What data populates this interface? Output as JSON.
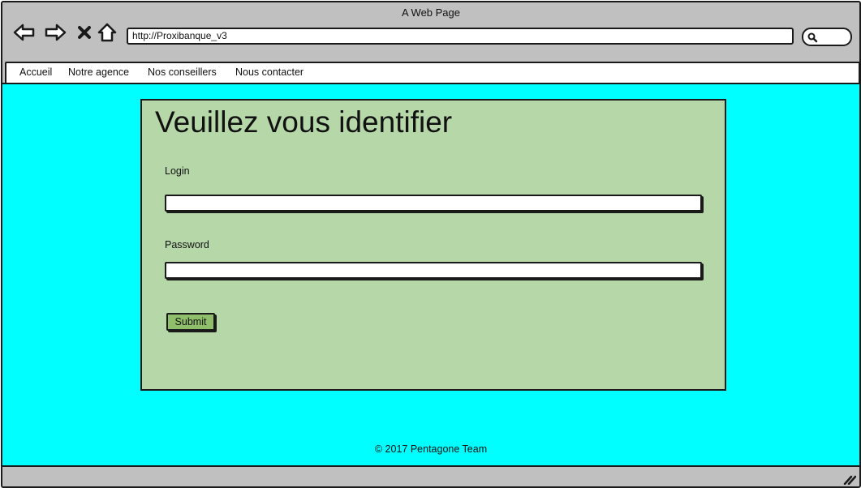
{
  "window": {
    "title": "A Web Page"
  },
  "browser": {
    "address": "http://Proxibanque_v3",
    "icons": [
      "back-arrow-icon",
      "forward-arrow-icon",
      "close-x-icon",
      "home-icon",
      "search-icon",
      "resize-grip-icon"
    ]
  },
  "menu": {
    "items": [
      {
        "label": "Accueil"
      },
      {
        "label": "Notre agence"
      },
      {
        "label": "Nos conseillers"
      },
      {
        "label": "Nous contacter"
      }
    ]
  },
  "login": {
    "title": "Veuillez vous identifier",
    "login_label": "Login",
    "login_value": "",
    "password_label": "Password",
    "password_value": "",
    "submit_label": "Submit"
  },
  "footer": {
    "text": "© 2017 Pentagone Team"
  },
  "colors": {
    "chrome": "#c0c0c0",
    "background": "#00ffff",
    "panel": "#b6d7a8",
    "button": "#8fbf6a",
    "border": "#1a1a1a"
  }
}
